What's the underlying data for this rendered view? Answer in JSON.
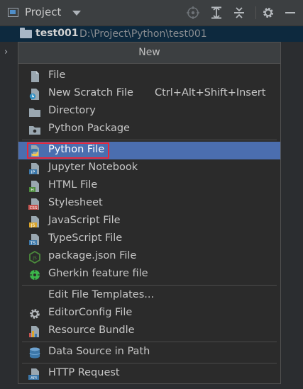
{
  "toolbar": {
    "title": "Project",
    "icons": [
      "crosshair-icon",
      "expand-all-icon",
      "collapse-all-icon",
      "gear-icon",
      "minimize-icon"
    ]
  },
  "tree": {
    "project_name": "test001",
    "project_path": "D:\\Project\\Python\\test001",
    "chevron": "›"
  },
  "menu": {
    "header": "New",
    "items": [
      {
        "label": "File",
        "icon": "file-icon"
      },
      {
        "label": "New Scratch File",
        "shortcut": "Ctrl+Alt+Shift+Insert",
        "icon": "scratch-file-icon"
      },
      {
        "label": "Directory",
        "icon": "directory-icon"
      },
      {
        "label": "Python Package",
        "icon": "python-package-icon"
      },
      {
        "label": "Python File",
        "icon": "python-file-icon",
        "selected": true
      },
      {
        "label": "Jupyter Notebook",
        "icon": "jupyter-icon",
        "badge": "IP"
      },
      {
        "label": "HTML File",
        "icon": "html-icon",
        "badge": "H"
      },
      {
        "label": "Stylesheet",
        "icon": "css-icon",
        "badge": "CSS"
      },
      {
        "label": "JavaScript File",
        "icon": "js-icon",
        "badge": "JS"
      },
      {
        "label": "TypeScript File",
        "icon": "ts-icon",
        "badge": "TS"
      },
      {
        "label": "package.json File",
        "icon": "nodejs-icon",
        "badge": "JS"
      },
      {
        "label": "Gherkin feature file",
        "icon": "gherkin-icon"
      },
      {
        "label": "Edit File Templates...",
        "icon": ""
      },
      {
        "label": "EditorConfig File",
        "icon": "editorconfig-gear-icon"
      },
      {
        "label": "Resource Bundle",
        "icon": "resource-bundle-icon"
      },
      {
        "label": "Data Source in Path",
        "icon": "database-icon"
      },
      {
        "label": "HTTP Request",
        "icon": "http-request-icon",
        "badge": "API"
      }
    ]
  },
  "colors": {
    "selection": "#4b6eaf",
    "highlight_outline": "#e8283a",
    "menu_bg": "#2b2b2b",
    "toolbar_bg": "#3c3f41"
  }
}
